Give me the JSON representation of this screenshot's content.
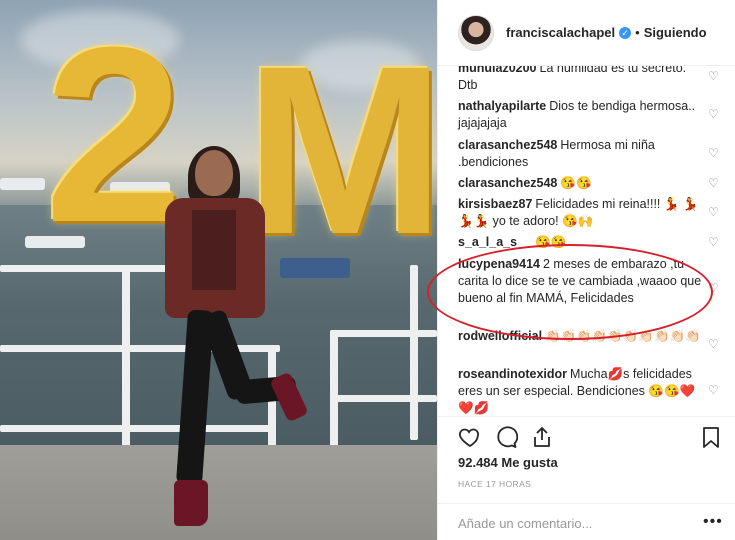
{
  "header": {
    "username": "franciscalachapel",
    "verified_mark": "✓",
    "separator": "•",
    "follow_status": "Siguiendo"
  },
  "comments": [
    {
      "user": "munulaz0200",
      "text": "La humildad es tu secreto. Dtb"
    },
    {
      "user": "nathalyapilarte",
      "text": "Dios te bendiga hermosa.. jajajajaja"
    },
    {
      "user": "clarasanchez548",
      "text": "Hermosa mi niña .bendiciones"
    },
    {
      "user": "clarasanchez548",
      "text": "😘😘"
    },
    {
      "user": "kirsisbaez87",
      "text": "Felicidades mi reina!!!! 💃 💃💃💃 yo te adoro! 😘🙌"
    },
    {
      "user": "s_a_l_a_s",
      "text": "😘😘"
    },
    {
      "user": "lucypena9414",
      "text": "2 meses de embarazo ,tu carita lo dice se te ve cambiada ,waaoo que bueno al fin MAMÁ, Felicidades"
    },
    {
      "user": "rodwellofficial",
      "text": "👏🏻👏🏻👏🏻👏🏻👏🏻👏🏻👏🏻👏🏻👏🏻👏🏻"
    },
    {
      "user": "roseandinotexidor",
      "text": "Mucha💋s felicidades eres un ser especial. Bendiciones 😘😘❤️❤️💋"
    }
  ],
  "photo": {
    "balloon_left": "2",
    "balloon_right": "M"
  },
  "actions": {
    "likes": "92.484 Me gusta",
    "time": "HACE 17 HORAS",
    "comment_placeholder": "Añade un comentario...",
    "more_label": "•••"
  },
  "colors": {
    "annotation_ellipse": "#d8202a",
    "verified": "#3897f0",
    "balloon_gold": "#e6b835"
  },
  "icons": [
    "heart-icon",
    "comment-icon",
    "share-icon",
    "bookmark-icon",
    "verified-icon",
    "more-icon"
  ]
}
